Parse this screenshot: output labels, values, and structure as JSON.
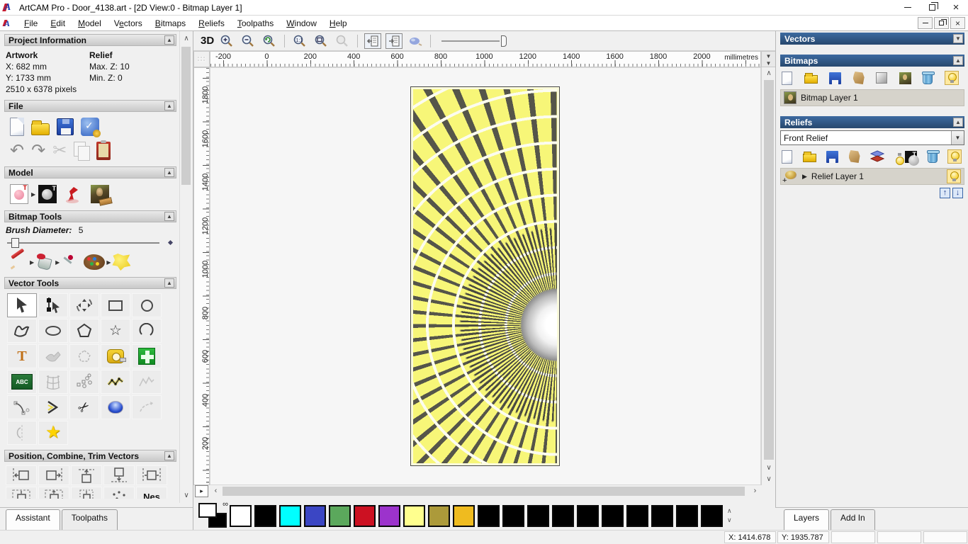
{
  "window": {
    "title": "ArtCAM Pro - Door_4138.art - [2D View:0 - Bitmap Layer 1]"
  },
  "menu": {
    "items": [
      {
        "label": "File",
        "accel": 0
      },
      {
        "label": "Edit",
        "accel": 0
      },
      {
        "label": "Model",
        "accel": 0
      },
      {
        "label": "Vectors",
        "accel": 1
      },
      {
        "label": "Bitmaps",
        "accel": 0
      },
      {
        "label": "Reliefs",
        "accel": 0
      },
      {
        "label": "Toolpaths",
        "accel": 0
      },
      {
        "label": "Window",
        "accel": 0
      },
      {
        "label": "Help",
        "accel": 0
      }
    ]
  },
  "left_panel": {
    "project": {
      "title": "Project Information",
      "artwork_label": "Artwork",
      "relief_label": "Relief",
      "artwork_x": "X: 682 mm",
      "artwork_y": "Y: 1733 mm",
      "artwork_pixels": "2510 x 6378 pixels",
      "relief_max": "Max. Z: 10",
      "relief_min": "Min. Z: 0"
    },
    "file": {
      "title": "File"
    },
    "model": {
      "title": "Model"
    },
    "bitmap_tools": {
      "title": "Bitmap Tools",
      "brush_label": "Brush Diameter:",
      "brush_value": "5"
    },
    "vector_tools": {
      "title": "Vector Tools",
      "text_glyph": "T",
      "abc_glyph": "ABC"
    },
    "position": {
      "title": "Position, Combine, Trim Vectors",
      "nes_label": "Nes"
    },
    "tabs": [
      {
        "label": "Assistant",
        "active": true
      },
      {
        "label": "Toolpaths",
        "active": false
      }
    ]
  },
  "canvas": {
    "toolbar": {
      "label_3d": "3D"
    },
    "hruler": {
      "ticks": [
        "-200",
        "0",
        "200",
        "400",
        "600",
        "800",
        "1000",
        "1200",
        "1400",
        "1600",
        "1800",
        "2000"
      ],
      "units": "millimetres"
    },
    "vruler": {
      "ticks": [
        "1800",
        "1600",
        "1400",
        "1200",
        "1000",
        "800",
        "600",
        "400",
        "200"
      ]
    }
  },
  "right_panel": {
    "vectors_title": "Vectors",
    "bitmaps_title": "Bitmaps",
    "bitmap_layer": "Bitmap Layer 1",
    "reliefs_title": "Reliefs",
    "relief_combo": "Front Relief",
    "relief_layer": "Relief Layer 1",
    "tabs": [
      {
        "label": "Layers",
        "active": true
      },
      {
        "label": "Add In",
        "active": false
      }
    ]
  },
  "palette": {
    "colors": [
      "#ffffff",
      "#000000",
      "#00ffff",
      "#3b46c4",
      "#5ba85c",
      "#cc1122",
      "#9c33cc",
      "#ffff8e",
      "#ac9a3a",
      "#efbb1f",
      "#000000",
      "#000000",
      "#000000",
      "#000000",
      "#000000",
      "#000000",
      "#000000",
      "#000000",
      "#000000",
      "#000000"
    ]
  },
  "status": {
    "x": "X: 1414.678",
    "y": "Y: 1935.787"
  },
  "icons": {
    "collapse_up": "▲",
    "expand_down": "▼",
    "flyout": "▶",
    "undo": "↶",
    "redo": "↷",
    "cut": "✂",
    "star_outline": "☆",
    "star_fill": "★",
    "trim": "✂",
    "scroll_up": "∧",
    "scroll_down": "∨",
    "left_arrow": "‹",
    "right_arrow": "›",
    "up_arrow": "↑",
    "down_arrow": "↓",
    "close": "×",
    "link": "∞",
    "pane_toggle": "▸",
    "dropdown": "▼",
    "transform": "↻",
    "arc": "◠",
    "expander": "▶"
  }
}
